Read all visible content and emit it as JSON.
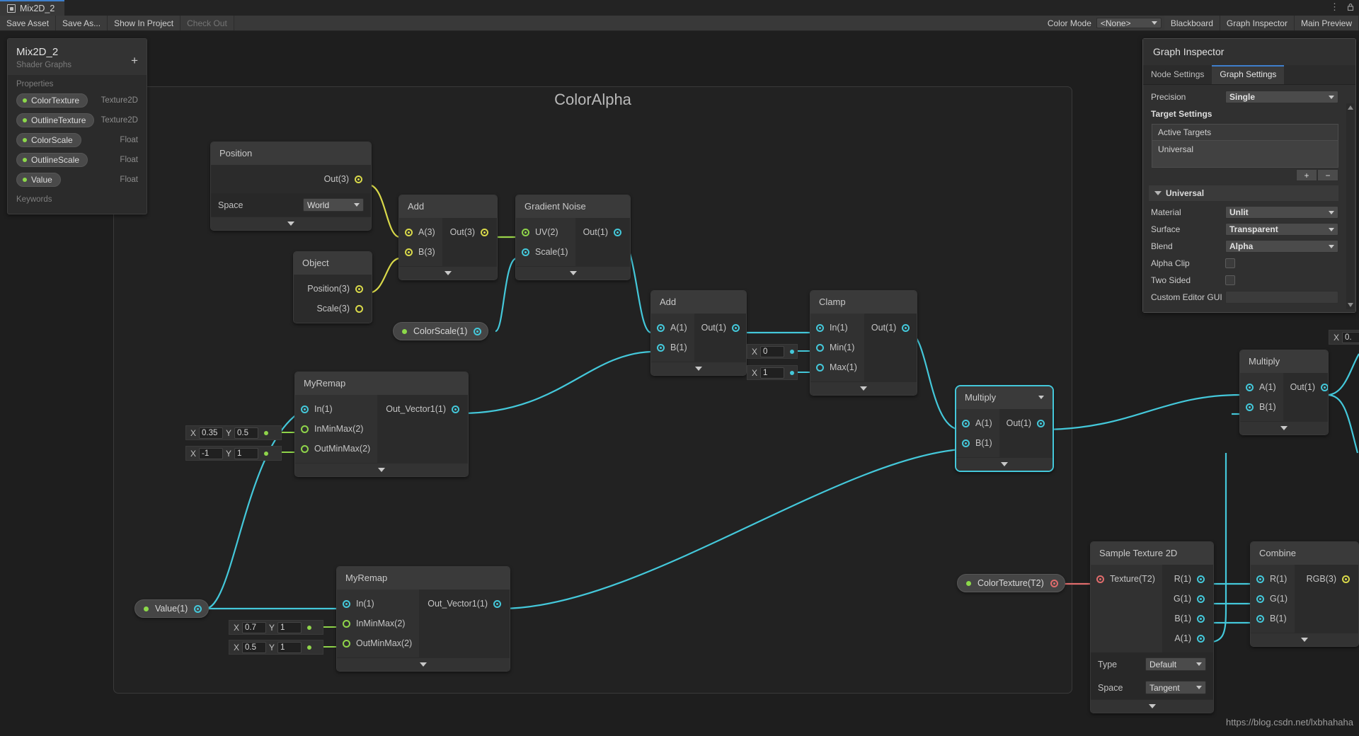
{
  "window": {
    "tab_label": "Mix2D_2",
    "tab_icon": "shader-graph-icon",
    "menu_icon": "kebab-menu-icon",
    "lock_icon": "lock-icon"
  },
  "toolbar": {
    "save_asset": "Save Asset",
    "save_as": "Save As...",
    "show_in_project": "Show In Project",
    "check_out": "Check Out",
    "color_mode_label": "Color Mode",
    "color_mode_value": "<None>",
    "blackboard": "Blackboard",
    "graph_inspector": "Graph Inspector",
    "main_preview": "Main Preview"
  },
  "blackboard": {
    "title": "Mix2D_2",
    "subtitle": "Shader Graphs",
    "add_label": "+",
    "properties_label": "Properties",
    "keywords_label": "Keywords",
    "properties": [
      {
        "name": "ColorTexture",
        "type": "Texture2D"
      },
      {
        "name": "OutlineTexture",
        "type": "Texture2D"
      },
      {
        "name": "ColorScale",
        "type": "Float"
      },
      {
        "name": "OutlineScale",
        "type": "Float"
      },
      {
        "name": "Value",
        "type": "Float"
      }
    ]
  },
  "graph": {
    "group_title": "ColorAlpha",
    "nodes": {
      "position": {
        "title": "Position",
        "out": "Out(3)",
        "space_label": "Space",
        "space_value": "World"
      },
      "object": {
        "title": "Object",
        "position_out": "Position(3)",
        "scale_out": "Scale(3)"
      },
      "add_vec3": {
        "title": "Add",
        "a": "A(3)",
        "b": "B(3)",
        "out": "Out(3)"
      },
      "gradient_noise": {
        "title": "Gradient Noise",
        "uv": "UV(2)",
        "scale": "Scale(1)",
        "out": "Out(1)"
      },
      "add_f1": {
        "title": "Add",
        "a": "A(1)",
        "b": "B(1)",
        "out": "Out(1)"
      },
      "clamp": {
        "title": "Clamp",
        "in": "In(1)",
        "min": "Min(1)",
        "max": "Max(1)",
        "out": "Out(1)",
        "min_axis": "X",
        "min_value": "0",
        "max_axis": "X",
        "max_value": "1"
      },
      "multiply_center": {
        "title": "Multiply",
        "a": "A(1)",
        "b": "B(1)",
        "out": "Out(1)",
        "selected": true
      },
      "multiply_right": {
        "title": "Multiply",
        "a": "A(1)",
        "b": "B(1)",
        "out": "Out(1)"
      },
      "myremap_top": {
        "title": "MyRemap",
        "in": "In(1)",
        "inminmax": "InMinMax(2)",
        "outminmax": "OutMinMax(2)",
        "out": "Out_Vector1(1)",
        "inminmax_x_label": "X",
        "inminmax_x": "0.35",
        "inminmax_y_label": "Y",
        "inminmax_y": "0.5",
        "outminmax_x_label": "X",
        "outminmax_x": "-1",
        "outminmax_y_label": "Y",
        "outminmax_y": "1"
      },
      "myremap_bottom": {
        "title": "MyRemap",
        "in": "In(1)",
        "inminmax": "InMinMax(2)",
        "outminmax": "OutMinMax(2)",
        "out": "Out_Vector1(1)",
        "inminmax_x_label": "X",
        "inminmax_x": "0.7",
        "inminmax_y_label": "Y",
        "inminmax_y": "1",
        "outminmax_x_label": "X",
        "outminmax_x": "0.5",
        "outminmax_y_label": "Y",
        "outminmax_y": "1"
      },
      "sample_texture": {
        "title": "Sample Texture 2D",
        "texture_in": "Texture(T2)",
        "r": "R(1)",
        "g": "G(1)",
        "b": "B(1)",
        "a": "A(1)",
        "type_label": "Type",
        "type_value": "Default",
        "space_label": "Space",
        "space_value": "Tangent"
      },
      "combine": {
        "title": "Combine",
        "r": "R(1)",
        "g": "G(1)",
        "b": "B(1)",
        "rgb": "RGB(3)"
      },
      "edge_field": {
        "axis": "X",
        "value": "0."
      }
    },
    "property_nodes": {
      "colorscale": "ColorScale(1)",
      "value": "Value(1)",
      "colortexture": "ColorTexture(T2)"
    }
  },
  "inspector": {
    "title": "Graph Inspector",
    "tabs": [
      {
        "label": "Node Settings",
        "active": false
      },
      {
        "label": "Graph Settings",
        "active": true
      }
    ],
    "precision_label": "Precision",
    "precision_value": "Single",
    "target_settings_label": "Target Settings",
    "active_targets_label": "Active Targets",
    "active_target": "Universal",
    "add_btn": "+",
    "remove_btn": "−",
    "universal_label": "Universal",
    "rows": [
      {
        "label": "Material",
        "value": "Unlit",
        "kind": "dropdown"
      },
      {
        "label": "Surface",
        "value": "Transparent",
        "kind": "dropdown"
      },
      {
        "label": "Blend",
        "value": "Alpha",
        "kind": "dropdown"
      },
      {
        "label": "Alpha Clip",
        "value": "",
        "kind": "checkbox"
      },
      {
        "label": "Two Sided",
        "value": "",
        "kind": "checkbox"
      },
      {
        "label": "Custom Editor GUI",
        "value": "",
        "kind": "text"
      }
    ]
  },
  "watermark": "https://blog.csdn.net/lxbhahaha",
  "colors": {
    "accent_blue": "#3e7fcc",
    "wire_cyan": "#44c8da",
    "wire_yellow": "#d9d94a",
    "wire_green": "#8fd44a",
    "wire_red": "#e06c6c",
    "panel_bg": "#2b2b2b",
    "node_bg": "#282828"
  }
}
